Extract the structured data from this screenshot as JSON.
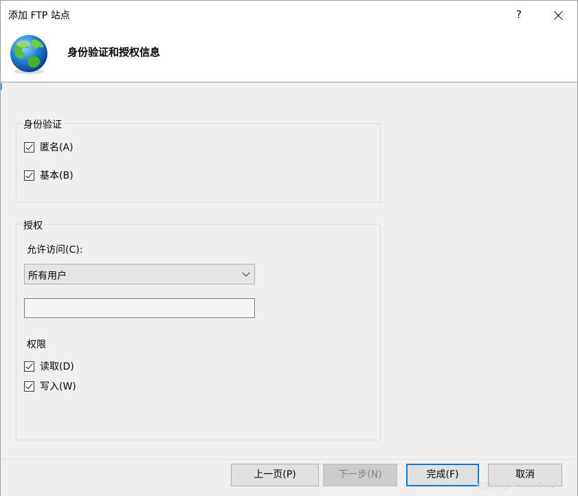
{
  "window": {
    "title": "添加 FTP 站点",
    "help_label": "?"
  },
  "header": {
    "title": "身份验证和授权信息",
    "icon": "globe-icon"
  },
  "authentication": {
    "group_label": "身份验证",
    "anonymous_label": "匿名(A)",
    "anonymous_checked": true,
    "basic_label": "基本(B)",
    "basic_checked": true
  },
  "authorization": {
    "group_label": "授权",
    "allow_access_label": "允许访问(C):",
    "allow_access_value": "所有用户",
    "user_field_value": "",
    "permissions_label": "权限",
    "read_label": "读取(D)",
    "read_checked": true,
    "write_label": "写入(W)",
    "write_checked": true
  },
  "footer": {
    "prev_label": "上一页(P)",
    "next_label": "下一步(N)",
    "finish_label": "完成(F)",
    "cancel_label": "取消"
  },
  "watermark": "CSDN @PHotoNHDZ",
  "colors": {
    "accent": "#0078d7",
    "dialog_bg": "#f0f0f0"
  }
}
